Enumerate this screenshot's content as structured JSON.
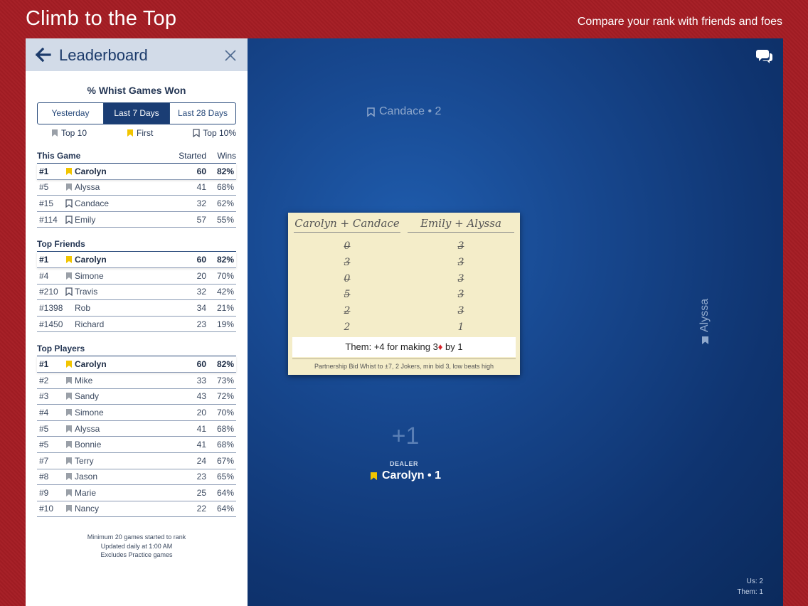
{
  "header": {
    "title": "Climb to the Top",
    "subtitle": "Compare your rank with friends and foes"
  },
  "leaderboard": {
    "title": "Leaderboard",
    "stat_title": "% Whist Games Won",
    "tabs": [
      {
        "label": "Yesterday",
        "active": false
      },
      {
        "label": "Last 7 Days",
        "active": true
      },
      {
        "label": "Last 28 Days",
        "active": false
      }
    ],
    "legend": [
      {
        "label": "Top 10",
        "flag": "gray"
      },
      {
        "label": "First",
        "flag": "gold"
      },
      {
        "label": "Top 10%",
        "flag": "outline"
      }
    ],
    "sections": [
      {
        "title": "This Game",
        "col_started": "Started",
        "col_wins": "Wins",
        "rows": [
          {
            "rank": "#1",
            "flag": "gold",
            "name": "Carolyn",
            "started": "60",
            "wins": "82%",
            "me": true
          },
          {
            "rank": "#5",
            "flag": "gray",
            "name": "Alyssa",
            "started": "41",
            "wins": "68%"
          },
          {
            "rank": "#15",
            "flag": "outline",
            "name": "Candace",
            "started": "32",
            "wins": "62%"
          },
          {
            "rank": "#114",
            "flag": "outline",
            "name": "Emily",
            "started": "57",
            "wins": "55%"
          }
        ]
      },
      {
        "title": "Top Friends",
        "col_started": "",
        "col_wins": "",
        "rows": [
          {
            "rank": "#1",
            "flag": "gold",
            "name": "Carolyn",
            "started": "60",
            "wins": "82%",
            "me": true
          },
          {
            "rank": "#4",
            "flag": "gray",
            "name": "Simone",
            "started": "20",
            "wins": "70%"
          },
          {
            "rank": "#210",
            "flag": "outline",
            "name": "Travis",
            "started": "32",
            "wins": "42%"
          },
          {
            "rank": "#1398",
            "flag": "none",
            "name": "Rob",
            "started": "34",
            "wins": "21%"
          },
          {
            "rank": "#1450",
            "flag": "none",
            "name": "Richard",
            "started": "23",
            "wins": "19%"
          }
        ]
      },
      {
        "title": "Top Players",
        "col_started": "",
        "col_wins": "",
        "rows": [
          {
            "rank": "#1",
            "flag": "gold",
            "name": "Carolyn",
            "started": "60",
            "wins": "82%",
            "me": true
          },
          {
            "rank": "#2",
            "flag": "gray",
            "name": "Mike",
            "started": "33",
            "wins": "73%"
          },
          {
            "rank": "#3",
            "flag": "gray",
            "name": "Sandy",
            "started": "43",
            "wins": "72%"
          },
          {
            "rank": "#4",
            "flag": "gray",
            "name": "Simone",
            "started": "20",
            "wins": "70%"
          },
          {
            "rank": "#5",
            "flag": "gray",
            "name": "Alyssa",
            "started": "41",
            "wins": "68%"
          },
          {
            "rank": "#5",
            "flag": "gray",
            "name": "Bonnie",
            "started": "41",
            "wins": "68%"
          },
          {
            "rank": "#7",
            "flag": "gray",
            "name": "Terry",
            "started": "24",
            "wins": "67%"
          },
          {
            "rank": "#8",
            "flag": "gray",
            "name": "Jason",
            "started": "23",
            "wins": "65%"
          },
          {
            "rank": "#9",
            "flag": "gray",
            "name": "Marie",
            "started": "25",
            "wins": "64%"
          },
          {
            "rank": "#10",
            "flag": "gray",
            "name": "Nancy",
            "started": "22",
            "wins": "64%"
          }
        ]
      }
    ],
    "footer": [
      "Minimum 20 games started to rank",
      "Updated daily at 1:00 AM",
      "Excludes Practice games"
    ]
  },
  "table": {
    "player_top": "Candace • 2",
    "player_right": "Alyssa",
    "score_delta": "+1",
    "dealer_label": "DEALER",
    "player_bottom": "Carolyn • 1",
    "score_us": "Us:  2",
    "score_them": "Them:  1"
  },
  "scorecard": {
    "team1": "Carolyn + Candace",
    "team2": "Emily + Alyssa",
    "team1_scores": [
      {
        "value": "0",
        "struck": true
      },
      {
        "value": "3",
        "struck": true
      },
      {
        "value": "0",
        "struck": true
      },
      {
        "value": "5",
        "struck": true
      },
      {
        "value": "2",
        "struck": true
      },
      {
        "value": "2",
        "struck": false
      }
    ],
    "team2_scores": [
      {
        "value": "3",
        "struck": true
      },
      {
        "value": "3",
        "struck": true
      },
      {
        "value": "3",
        "struck": true
      },
      {
        "value": "3",
        "struck": true
      },
      {
        "value": "3",
        "struck": true
      },
      {
        "value": "1",
        "struck": false
      }
    ],
    "result_prefix": "Them: +4 for making 3",
    "result_suit": "♦",
    "result_suffix": " by 1",
    "rules": "Partnership Bid Whist to ±7, 2 Jokers, min bid 3, low beats high"
  },
  "colors": {
    "frame_red": "#a51d24",
    "table_blue": "#17478e",
    "header_blue": "#1c3b6b",
    "flag_gold": "#f2c500",
    "flag_gray": "#9aa0a8"
  }
}
